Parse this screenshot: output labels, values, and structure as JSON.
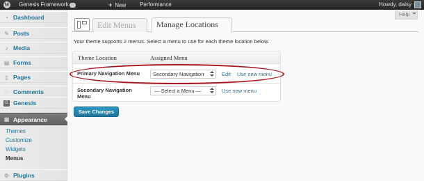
{
  "adminbar": {
    "site_name": "Genesis Framework",
    "new_label": "New",
    "performance_label": "Performance",
    "howdy": "Howdy, daisy"
  },
  "sidebar": {
    "items": [
      {
        "label": "Dashboard",
        "icon": "dashboard-icon"
      },
      {
        "label": "Posts",
        "icon": "pin-icon"
      },
      {
        "label": "Media",
        "icon": "media-icon"
      },
      {
        "label": "Forms",
        "icon": "forms-icon"
      },
      {
        "label": "Pages",
        "icon": "page-icon"
      },
      {
        "label": "Comments",
        "icon": "comment-icon"
      },
      {
        "label": "Genesis",
        "icon": "genesis-icon"
      },
      {
        "label": "Appearance",
        "icon": "appearance-icon"
      },
      {
        "label": "Plugins",
        "icon": "plugin-icon"
      }
    ],
    "submenu": [
      "Themes",
      "Customize",
      "Widgets",
      "Menus"
    ]
  },
  "help": {
    "label": "Help"
  },
  "tabs": [
    {
      "label": "Edit Menus"
    },
    {
      "label": "Manage Locations"
    }
  ],
  "intro": "Your theme supports 2 menus. Select a menu to use for each theme location below.",
  "table": {
    "headers": [
      "Theme Location",
      "Assigned Menu"
    ],
    "rows": [
      {
        "location": "Primary Navigation Menu",
        "selected": "Secondary Navigation",
        "edit": "Edit",
        "use_new": "Use new menu"
      },
      {
        "location_line1": "Secondary Navigation",
        "location_line2": "Menu",
        "selected": "— Select a Menu —",
        "use_new": "Use new menu"
      }
    ]
  },
  "save_label": "Save Changes",
  "colors": {
    "link": "#21759b",
    "highlight_oval": "#a8141b",
    "current_menu": "#6e6e6e",
    "button": "#21759b"
  }
}
